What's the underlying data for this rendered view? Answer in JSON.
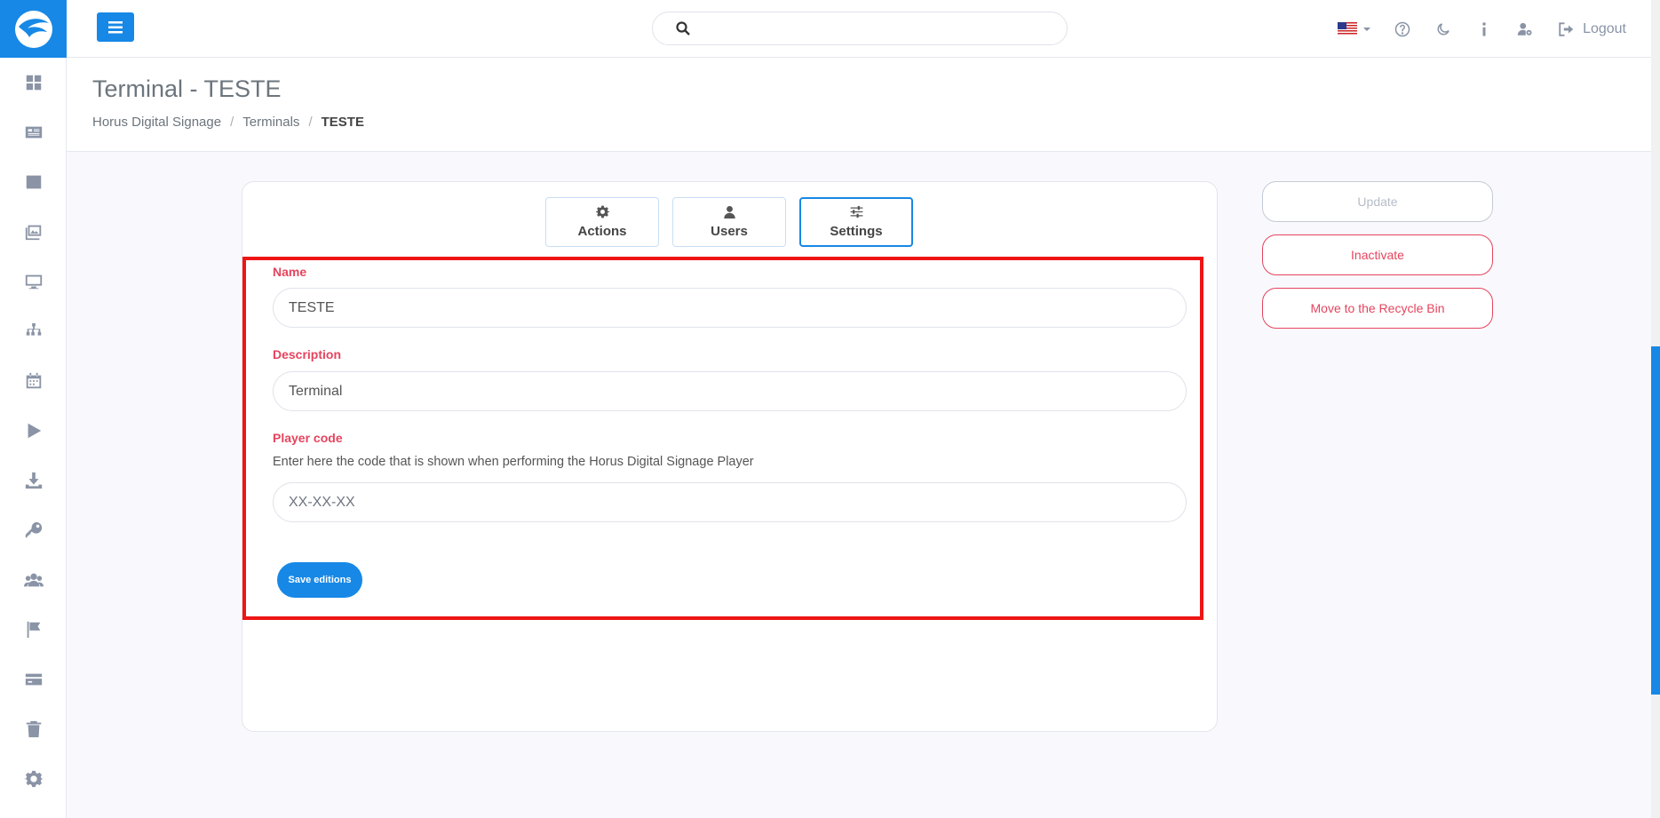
{
  "brand": {
    "accent": "#1788e6",
    "danger": "#e5445e",
    "highlight": "#ee1515"
  },
  "sidebar": {
    "items": [
      {
        "icon": "dashboard-icon"
      },
      {
        "icon": "news-icon"
      },
      {
        "icon": "inbox-icon"
      },
      {
        "icon": "images-icon"
      },
      {
        "icon": "monitor-icon"
      },
      {
        "icon": "sitemap-icon"
      },
      {
        "icon": "calendar-icon"
      },
      {
        "icon": "play-icon"
      },
      {
        "icon": "download-icon"
      },
      {
        "icon": "key-icon"
      },
      {
        "icon": "users-icon"
      },
      {
        "icon": "flag-icon"
      },
      {
        "icon": "card-icon"
      },
      {
        "icon": "trash-icon"
      },
      {
        "icon": "gear-icon"
      }
    ]
  },
  "topbar": {
    "search_placeholder": "",
    "logout_label": "Logout"
  },
  "header": {
    "title": "Terminal - TESTE",
    "breadcrumb": [
      "Horus Digital Signage",
      "Terminals",
      "TESTE"
    ]
  },
  "tabs": [
    {
      "label": "Actions",
      "icon": "gear-icon"
    },
    {
      "label": "Users",
      "icon": "user-icon"
    },
    {
      "label": "Settings",
      "icon": "sliders-icon",
      "active": true
    }
  ],
  "form": {
    "name_label": "Name",
    "name_value": "TESTE",
    "description_label": "Description",
    "description_value": "Terminal",
    "player_code_label": "Player code",
    "player_code_help": "Enter here the code that is shown when performing the Horus Digital Signage Player",
    "player_code_placeholder": "XX-XX-XX",
    "player_code_value": "",
    "save_label": "Save editions"
  },
  "actions": {
    "update_label": "Update",
    "inactivate_label": "Inactivate",
    "recycle_label": "Move to the Recycle Bin"
  }
}
